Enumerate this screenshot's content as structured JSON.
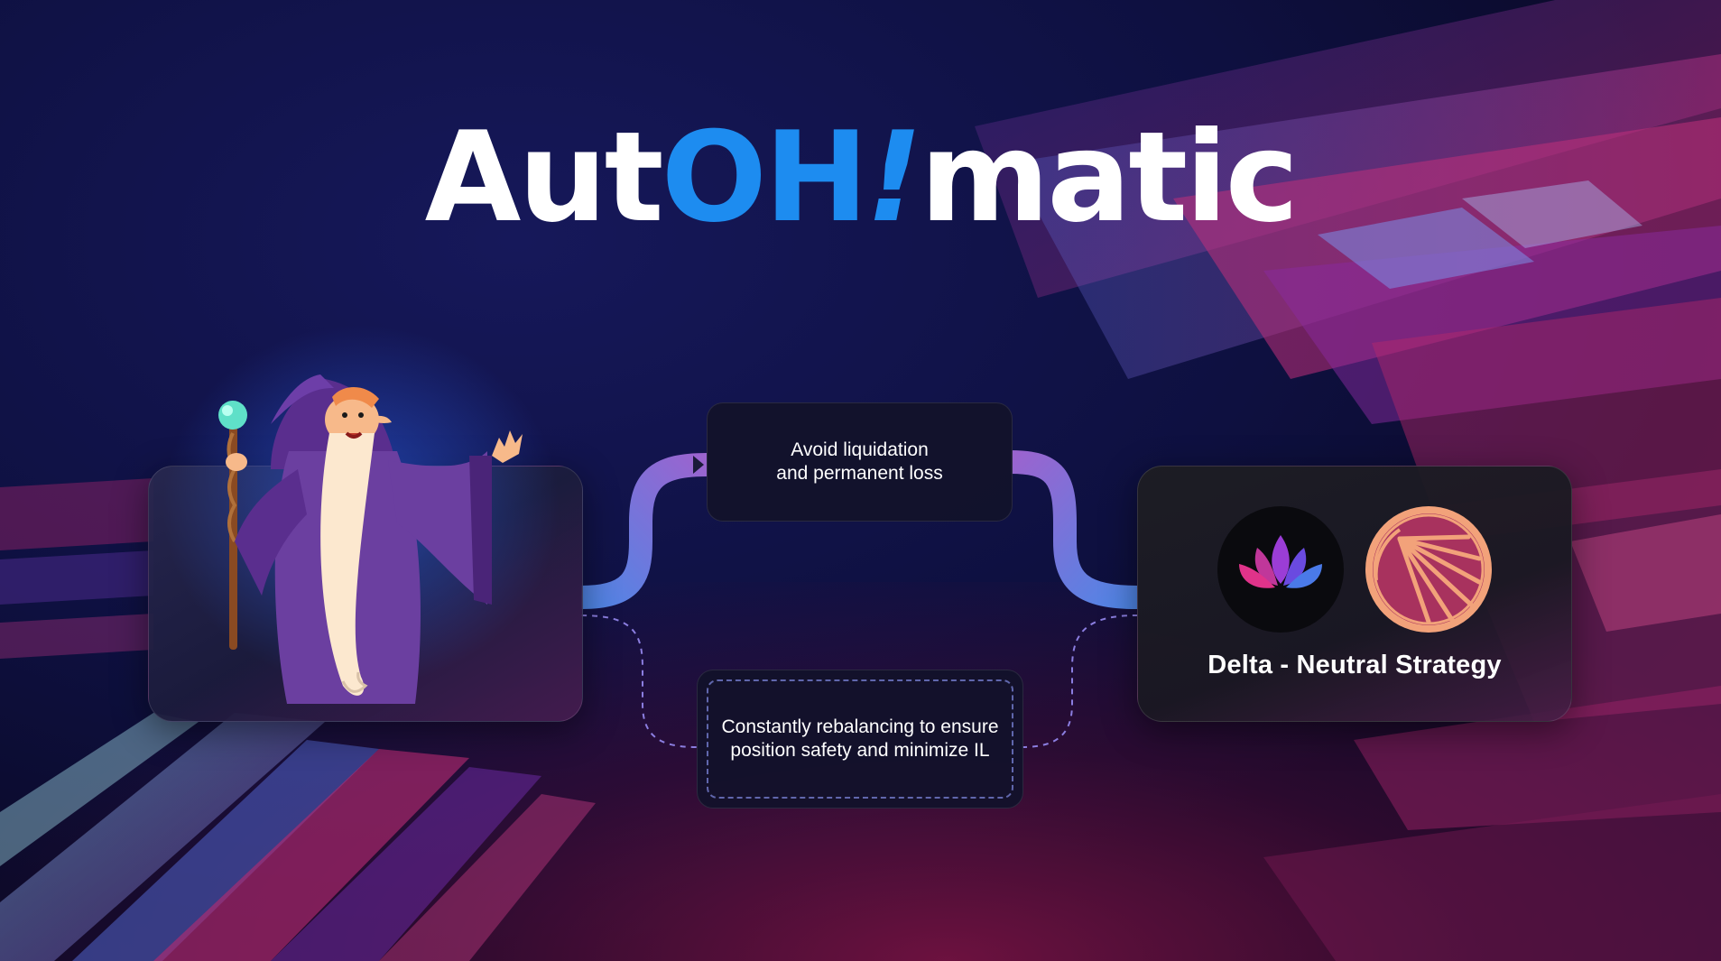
{
  "title": {
    "part1": "Aut",
    "accent": "OH",
    "exclaim": "!",
    "part2": "matic"
  },
  "flow": {
    "top_box": {
      "line1": "Avoid liquidation",
      "line2": "and permanent loss"
    },
    "bottom_box": {
      "line1": "Constantly rebalancing to ensure",
      "line2": "position safety and minimize IL"
    }
  },
  "strategy": {
    "label": "Delta - Neutral Strategy",
    "logos": [
      "lotus-moon-logo",
      "sun-rays-logo"
    ]
  },
  "colors": {
    "accent_blue": "#1d8cf0",
    "wire_blue": "#4f86e6",
    "wire_purple": "#9a64cf",
    "wizard_robe": "#6b3fa0",
    "logo_orange": "#f2a27a"
  }
}
